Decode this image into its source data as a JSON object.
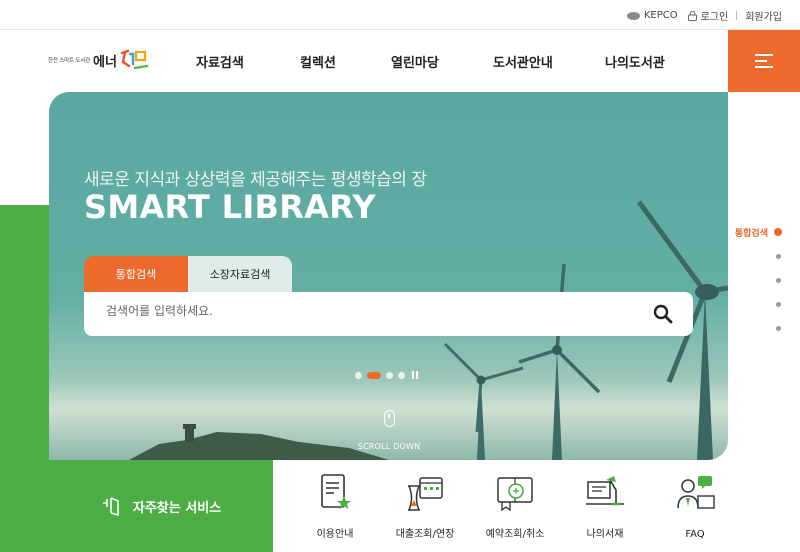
{
  "topbar": {
    "brand": "KEPCO",
    "login": "로그인",
    "signup": "회원가입"
  },
  "header": {
    "logo_small": "한전 스마트 도서관",
    "logo_big": "에너",
    "logo_mark": "지",
    "nav": [
      "자료검색",
      "컬렉션",
      "열린마당",
      "도서관안내",
      "나의도서관"
    ]
  },
  "hero": {
    "subtitle": "새로운 지식과 상상력을 제공해주는 평생학습의 장",
    "title": "SMART LIBRARY",
    "tabs": [
      "통합검색",
      "소장자료검색"
    ],
    "search_placeholder": "검색어를 입력하세요.",
    "slide_count": 4,
    "active_slide": 2,
    "scroll_label": "SCROLL DOWN"
  },
  "side_nav": {
    "active_label": "통합검색",
    "count": 5
  },
  "quick": {
    "label": "자주찾는 서비스",
    "items": [
      "이용안내",
      "대출조회/연장",
      "예약조회/취소",
      "나의서재",
      "FAQ"
    ]
  },
  "colors": {
    "accent": "#ec6a2c",
    "green": "#4cae44"
  }
}
